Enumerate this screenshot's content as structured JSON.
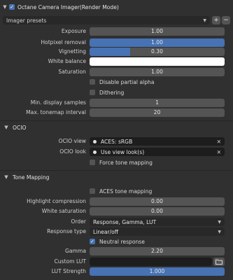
{
  "panel": {
    "title": "Octane Camera Imager(Render Mode)",
    "enabled": true
  },
  "presets": {
    "label": "Imager presets",
    "add": "+",
    "remove": "−"
  },
  "imager": {
    "exposure": {
      "label": "Exposure",
      "value": "1.00"
    },
    "hotpixel": {
      "label": "Hotpixel removal",
      "value": "1.00",
      "fraction": 1.0
    },
    "vignetting": {
      "label": "Vignetting",
      "value": "0.30",
      "fraction": 0.3
    },
    "white_balance": {
      "label": "White balance",
      "color": "#ffffff"
    },
    "saturation": {
      "label": "Saturation",
      "value": "1.00"
    },
    "disable_partial_alpha": {
      "label": "Disable partial alpha",
      "checked": false
    },
    "dithering": {
      "label": "Dithering",
      "checked": false
    },
    "min_display_samples": {
      "label": "Min. display samples",
      "value": "1"
    },
    "max_tonemap_interval": {
      "label": "Max. tonemap interval",
      "value": "20"
    }
  },
  "ocio": {
    "title": "OCIO",
    "view": {
      "label": "OCIO view",
      "value": "ACES: sRGB",
      "clear": "✕"
    },
    "look": {
      "label": "OCIO look",
      "value": "Use view look(s)",
      "clear": "✕"
    },
    "force_tone_mapping": {
      "label": "Force tone mapping",
      "checked": false
    }
  },
  "tone_mapping": {
    "title": "Tone Mapping",
    "aces": {
      "label": "ACES tone mapping",
      "checked": false
    },
    "highlight_compression": {
      "label": "Highlight compression",
      "value": "0.00"
    },
    "white_saturation": {
      "label": "White saturation",
      "value": "0.00"
    },
    "order": {
      "label": "Order",
      "value": "Response, Gamma, LUT"
    },
    "response_type": {
      "label": "Response type",
      "value": "Linear/off"
    },
    "neutral_response": {
      "label": "Neutral response",
      "checked": true
    },
    "gamma": {
      "label": "Gamma",
      "value": "2.20"
    },
    "custom_lut": {
      "label": "Custom LUT",
      "value": ""
    },
    "lut_strength": {
      "label": "LUT Strength",
      "value": "1.000",
      "fraction": 1.0
    }
  },
  "colors": {
    "accent": "#4772b3",
    "background": "#303030",
    "field": "#545454"
  },
  "icons": {
    "collapse": "chevron-down-icon",
    "check": "checkmark-icon",
    "folder": "folder-icon"
  }
}
